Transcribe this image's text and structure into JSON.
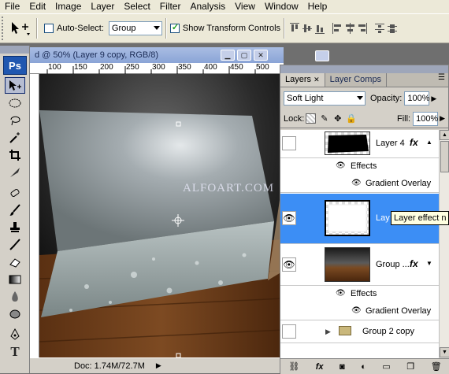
{
  "menu": [
    "File",
    "Edit",
    "Image",
    "Layer",
    "Select",
    "Filter",
    "Analysis",
    "View",
    "Window",
    "Help"
  ],
  "options": {
    "auto_select_label": "Auto-Select:",
    "auto_select_checked": false,
    "auto_select_value": "Group",
    "show_transform_label": "Show Transform Controls",
    "show_transform_checked": true
  },
  "document": {
    "title": "d @ 50% (Layer 9 copy, RGB/8)",
    "ruler_labels": [
      "100",
      "150",
      "200",
      "250",
      "300",
      "350",
      "400",
      "450",
      "500"
    ],
    "watermark": "ALFOART.COM",
    "status": "Doc: 1.74M/72.7M"
  },
  "toolbox": {
    "logo": "Ps"
  },
  "layers_panel": {
    "tabs": [
      "Layers",
      "Layer Comps"
    ],
    "blend_mode": "Soft Light",
    "opacity_label": "Opacity:",
    "opacity_value": "100%",
    "lock_label": "Lock:",
    "fill_label": "Fill:",
    "fill_value": "100%",
    "layers": [
      {
        "name": "Layer 4",
        "visible": false,
        "fx": "fx"
      },
      {
        "name": "Effects",
        "kind": "effects-header"
      },
      {
        "name": "Gradient Overlay",
        "kind": "effect"
      },
      {
        "name": "Lay",
        "visible": true,
        "selected": true
      },
      {
        "name": "Group ...",
        "visible": true,
        "fx": "fx"
      },
      {
        "name": "Effects",
        "kind": "effects-header"
      },
      {
        "name": "Gradient Overlay",
        "kind": "effect"
      },
      {
        "name": "Group 2 copy",
        "visible": false,
        "kind": "group"
      }
    ]
  },
  "tooltip": "Layer effect n",
  "colors": {
    "selection": "#3c8ef5",
    "ps_blue": "#2057b0",
    "chrome": "#d4d0c8"
  }
}
